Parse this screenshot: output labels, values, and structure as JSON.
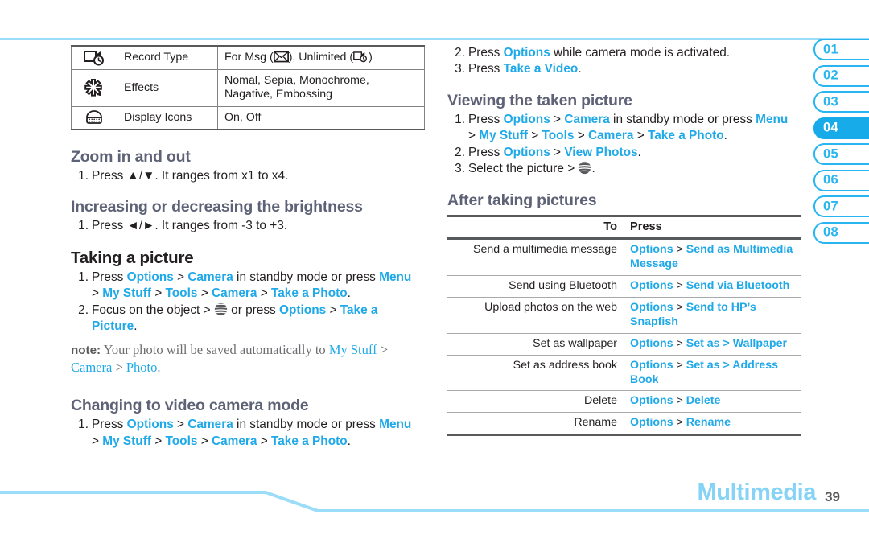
{
  "page": {
    "footer_title": "Multimedia",
    "footer_page": "39",
    "accent_blue": "#1fa9e8",
    "tab_blue": "#29b6f0",
    "heading_grey": "#5d6276",
    "footer_title_color": "#86d3f5"
  },
  "chapter_tabs": [
    {
      "label": "01",
      "active": false
    },
    {
      "label": "02",
      "active": false
    },
    {
      "label": "03",
      "active": false
    },
    {
      "label": "04",
      "active": true
    },
    {
      "label": "05",
      "active": false
    },
    {
      "label": "06",
      "active": false
    },
    {
      "label": "07",
      "active": false
    },
    {
      "label": "08",
      "active": false
    }
  ],
  "spec_table": {
    "rows": [
      {
        "icon": "record-type-icon",
        "name": "Record Type",
        "value_pre": "For Msg (",
        "value_mid": "), Unlimited (",
        "value_post": ")"
      },
      {
        "icon": "effects-icon",
        "name": "Effects",
        "value": "Nomal, Sepia, Monochrome, Nagative, Embossing"
      },
      {
        "icon": "display-icons-icon",
        "name": "Display Icons",
        "value": "On, Off"
      }
    ]
  },
  "left_column": {
    "zoom": {
      "heading": "Zoom in and out",
      "step1_num": "1.",
      "step1_a": "Press ",
      "step1_keys": "▲/▼",
      "step1_b": ". It ranges from x1 to x4."
    },
    "brightness": {
      "heading": "Increasing or decreasing the brightness",
      "step1_num": "1.",
      "step1_a": "Press ",
      "step1_keys": "◄/►",
      "step1_b": ". It ranges from -3 to +3."
    },
    "taking_picture": {
      "heading": "Taking a picture",
      "step1_num": "1.",
      "step1_press": "Press ",
      "step1_options": "Options",
      "step1_gt1": " > ",
      "step1_camera": "Camera",
      "step1_mid": " in standby mode or press ",
      "step1_menu": "Menu",
      "step1_cont_gt": "> ",
      "step1_mystuff": "My Stuff",
      "step1_gt2": " > ",
      "step1_tools": "Tools",
      "step1_gt3": " > ",
      "step1_camera2": "Camera",
      "step1_gt4": " > ",
      "step1_takephoto": "Take a Photo",
      "step1_dot": ".",
      "step2_num": "2.",
      "step2_a": "Focus on the object > ",
      "step2_b": " or press ",
      "step2_options": "Options",
      "step2_gt": " > ",
      "step2_take": "Take a",
      "step2_picture": "Picture",
      "step2_dot": ".",
      "note_label": "note:",
      "note_a": " Your photo will be saved automatically to ",
      "note_mystuff": "My Stuff",
      "note_gt1": " > ",
      "note_camera": "Camera",
      "note_gt2": " > ",
      "note_photo": "Photo",
      "note_dot": "."
    },
    "video_mode": {
      "heading": "Changing to video camera mode",
      "step1_num": "1.",
      "step1_press": "Press ",
      "step1_options": "Options",
      "step1_gt1": " > ",
      "step1_camera": "Camera",
      "step1_mid": " in standby mode or press ",
      "step1_menu": "Menu",
      "step1_cont_gt": "> ",
      "step1_mystuff": "My Stuff",
      "step1_gt2": " > ",
      "step1_tools": "Tools",
      "step1_gt3": " > ",
      "step1_camera2": "Camera",
      "step1_gt4": " > ",
      "step1_takephoto": "Take a Photo",
      "step1_dot": "."
    }
  },
  "right_column": {
    "video_cont": {
      "step2_num": "2.",
      "step2_a": "Press ",
      "step2_options": "Options",
      "step2_b": " while camera mode is activated.",
      "step3_num": "3.",
      "step3_a": "Press ",
      "step3_take": "Take a Video",
      "step3_dot": "."
    },
    "viewing": {
      "heading": "Viewing the taken picture",
      "step1_num": "1.",
      "step1_press": "Press ",
      "step1_options": "Options",
      "step1_gt1": " > ",
      "step1_camera": "Camera",
      "step1_mid": " in standby mode or press ",
      "step1_menu": "Menu",
      "step1_cont_gt": "> ",
      "step1_mystuff": "My Stuff",
      "step1_gt2": " > ",
      "step1_tools": "Tools",
      "step1_gt3": " > ",
      "step1_camera2": "Camera",
      "step1_gt4": " > ",
      "step1_takephoto": "Take a Photo",
      "step1_dot": ".",
      "step2_num": "2.",
      "step2_a": "Press ",
      "step2_options": "Options",
      "step2_gt": " > ",
      "step2_view": "View Photos",
      "step2_dot": ".",
      "step3_num": "3.",
      "step3_a": "Select the picture > ",
      "step3_dot": "."
    },
    "after_pictures": {
      "heading": "After taking pictures",
      "col_to": "To",
      "col_press": "Press",
      "rows": [
        {
          "to": "Send a multimedia message",
          "press_1": "Options",
          "gt": " > ",
          "press_2": "Send as Multimedia Message"
        },
        {
          "to": "Send using Bluetooth",
          "press_1": "Options",
          "gt": " > ",
          "press_2": "Send via Bluetooth"
        },
        {
          "to": "Upload photos on the web",
          "press_1": "Options",
          "gt": " > ",
          "press_2": "Send to HP’s Snapfish"
        },
        {
          "to": "Set as wallpaper",
          "press_1": "Options",
          "gt": " > ",
          "press_2": "Set as > Wallpaper"
        },
        {
          "to": "Set as address book",
          "press_1": "Options",
          "gt": " > ",
          "press_2": "Set as > Address Book"
        },
        {
          "to": "Delete",
          "press_1": "Options",
          "gt": " > ",
          "press_2": "Delete"
        },
        {
          "to": "Rename",
          "press_1": "Options",
          "gt": " > ",
          "press_2": "Rename"
        }
      ]
    }
  }
}
